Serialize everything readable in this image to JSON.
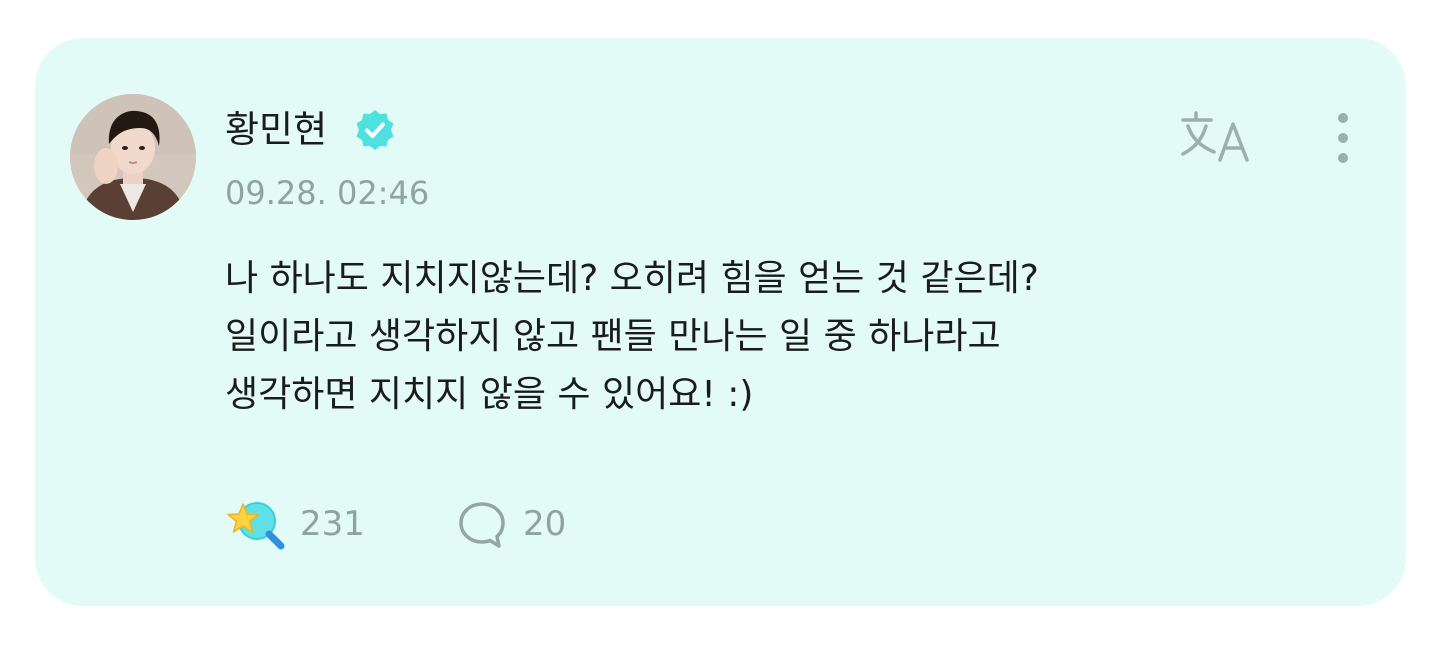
{
  "post": {
    "author": {
      "name": "황민현",
      "verified": true,
      "avatar_icon": "profile-photo"
    },
    "timestamp": "09.28. 02:46",
    "body_lines": [
      "나 하나도 지치지않는데? 오히려 힘을 얻는 것 같은데?",
      "일이라고 생각하지 않고 팬들 만나는 일 중 하나라고",
      "생각하면 지치지 않을 수 있어요! :)"
    ],
    "reactions": {
      "like_icon": "star-lollipop-icon",
      "like_count": "231",
      "comment_icon": "speech-bubble-icon",
      "comment_count": "20"
    },
    "header_actions": {
      "translate_icon": "translate-icon",
      "more_icon": "more-vertical-icon"
    }
  },
  "colors": {
    "card_background": "#e3fbf6",
    "accent": "#4ee1df",
    "muted_text": "#90a3a0",
    "primary_text": "#1b1b1b"
  }
}
